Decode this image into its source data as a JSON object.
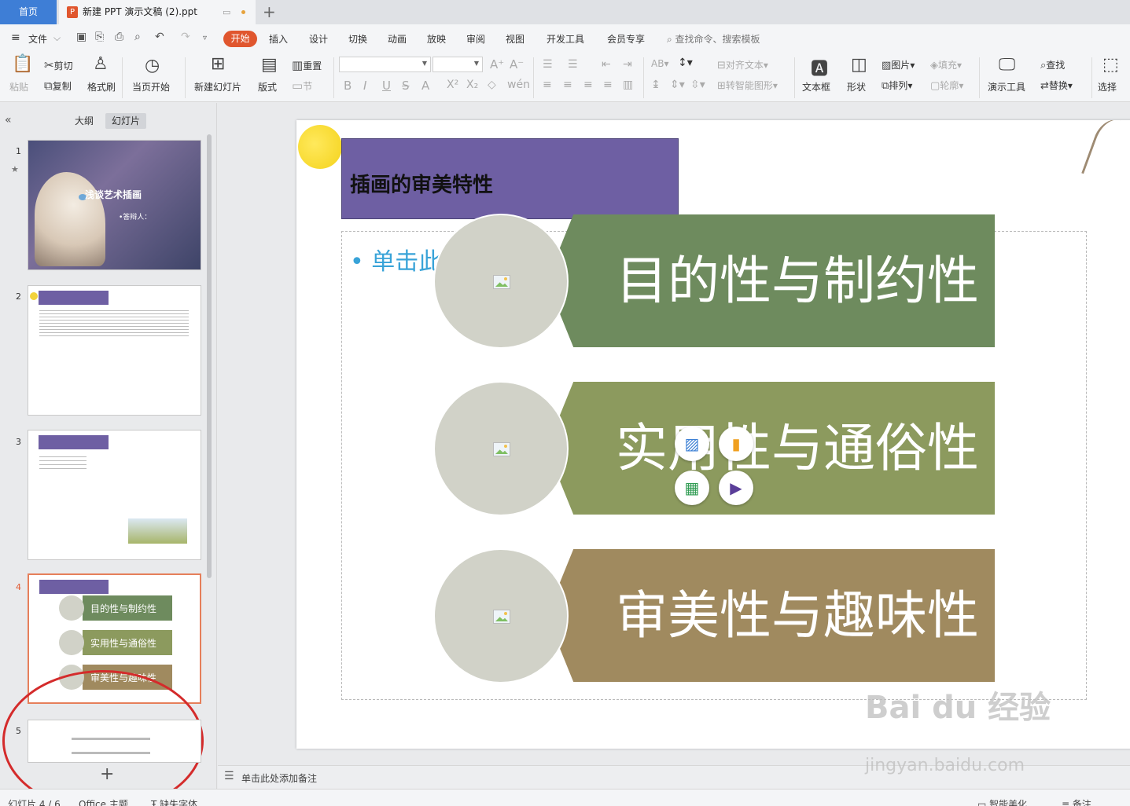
{
  "tabs": {
    "home": "首页",
    "doc_title": "新建 PPT 演示文稿 (2).ppt"
  },
  "menu": {
    "file": "文件",
    "items": [
      "开始",
      "插入",
      "设计",
      "切换",
      "动画",
      "放映",
      "审阅",
      "视图",
      "开发工具",
      "会员专享"
    ],
    "search": "查找命令、搜索模板"
  },
  "ribbon": {
    "paste": "粘贴",
    "cut": "剪切",
    "copy": "复制",
    "format_painter": "格式刷",
    "play_from_current": "当页开始",
    "new_slide": "新建幻灯片",
    "layout": "版式",
    "reset": "重置",
    "section": "节",
    "align_text": "对齐文本",
    "smartart": "转智能图形",
    "textbox": "文本框",
    "shape": "形状",
    "picture": "图片",
    "arrange": "排列",
    "fill": "填充",
    "outline": "轮廓",
    "tools": "演示工具",
    "find": "查找",
    "replace": "替换",
    "select": "选择"
  },
  "panel": {
    "tab_outline": "大纲",
    "tab_slides": "幻灯片",
    "slides": [
      {
        "num": "1",
        "title": "浅谈艺术插画",
        "sub": "•答辩人："
      },
      {
        "num": "2"
      },
      {
        "num": "3"
      },
      {
        "num": "4",
        "items": [
          "目的性与制约性",
          "实用性与通俗性",
          "审美性与趣味性"
        ]
      },
      {
        "num": "5"
      }
    ],
    "add": "+"
  },
  "slide": {
    "title": "插画的审美特性",
    "placeholder": "• 单击此处添加文本",
    "items": [
      {
        "text": "目的性与制约性",
        "color": "#6e8b5e"
      },
      {
        "text": "实用性与通俗性",
        "color": "#8c9a5e"
      },
      {
        "text": "审美性与趣味性",
        "color": "#a08a5f"
      }
    ]
  },
  "notes": "单击此处添加备注",
  "status": {
    "slide": "幻灯片 4 / 6",
    "theme": "Office 主题",
    "font": "缺失字体",
    "beautify": "智能美化",
    "notes": "备注"
  },
  "watermark": {
    "brand": "Bai du 经验",
    "url": "jingyan.baidu.com"
  }
}
